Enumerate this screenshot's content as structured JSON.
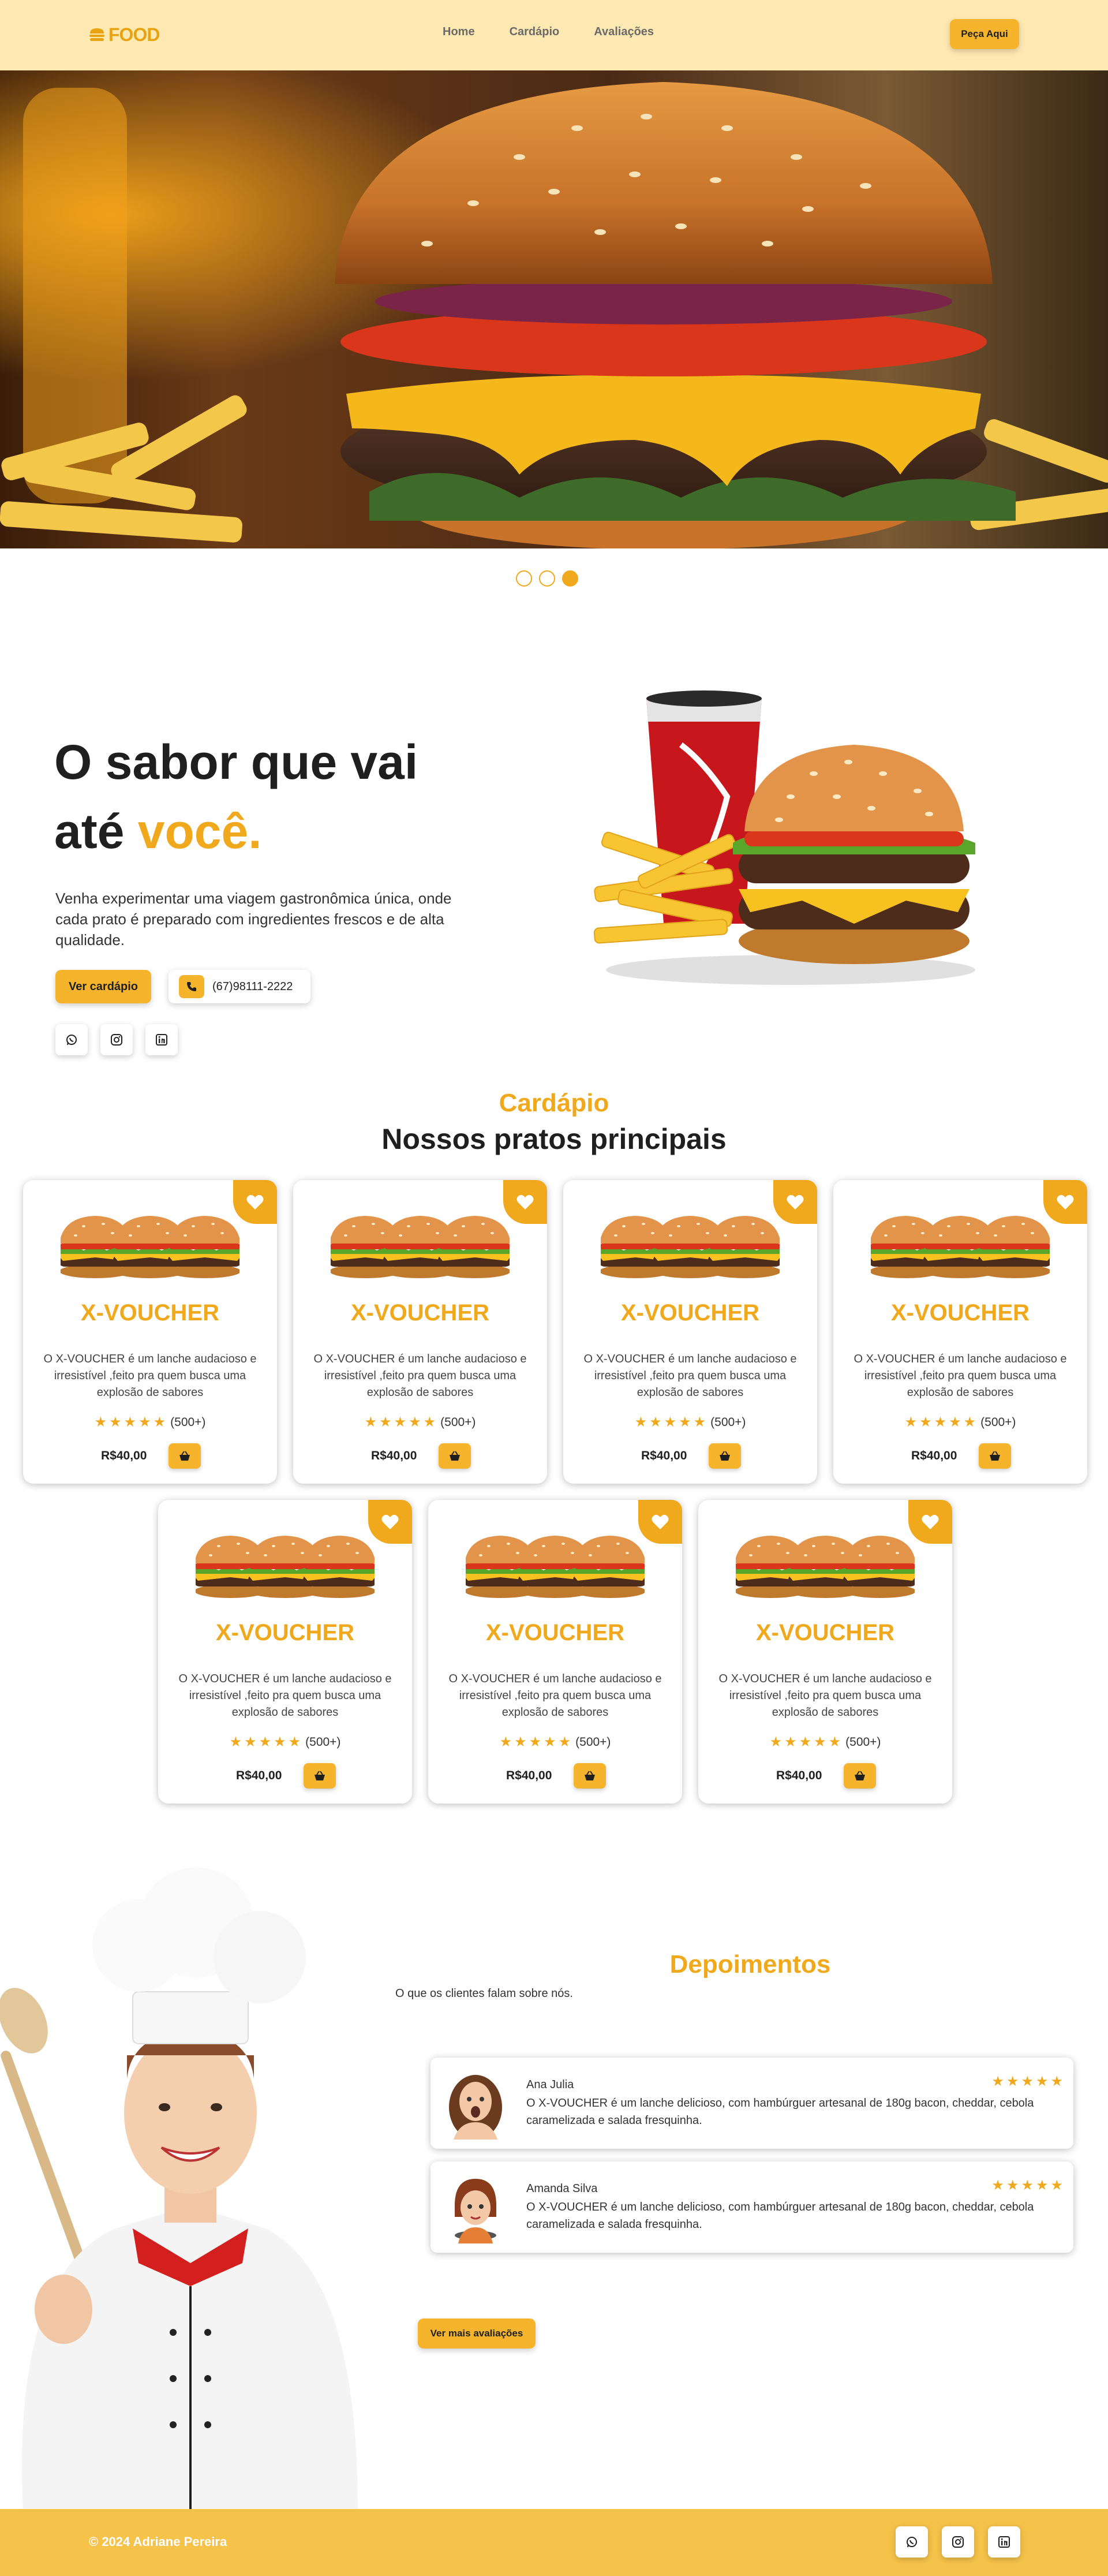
{
  "header": {
    "logo_text": "FOOD",
    "nav": [
      "Home",
      "Cardápio",
      "Avaliações"
    ],
    "order_button": "Peça Aqui"
  },
  "hero": {
    "slides": 3,
    "active_slide": 3
  },
  "intro": {
    "title_line1": "O sabor que vai",
    "title_line2_plain": "até ",
    "title_line2_accent": "você.",
    "description": "Venha experimentar uma viagem gastronômica única, onde cada prato é preparado com ingredientes frescos e de alta qualidade.",
    "menu_button": "Ver cardápio",
    "phone": "(67)98111-2222",
    "social_icons": [
      "whatsapp-icon",
      "instagram-icon",
      "linkedin-icon"
    ]
  },
  "menu": {
    "label": "Cardápio",
    "title": "Nossos pratos principais",
    "items": [
      {
        "name": "X-VOUCHER",
        "description": "O X-VOUCHER é um lanche audacioso e irresistível ,feito pra quem busca uma explosão de sabores",
        "rating": 5,
        "count": "(500+)",
        "price": "R$40,00"
      },
      {
        "name": "X-VOUCHER",
        "description": "O X-VOUCHER é um lanche audacioso e irresistível ,feito pra quem busca uma explosão de sabores",
        "rating": 5,
        "count": "(500+)",
        "price": "R$40,00"
      },
      {
        "name": "X-VOUCHER",
        "description": "O X-VOUCHER é um lanche audacioso e irresistível ,feito pra quem busca uma explosão de sabores",
        "rating": 5,
        "count": "(500+)",
        "price": "R$40,00"
      },
      {
        "name": "X-VOUCHER",
        "description": "O X-VOUCHER é um lanche audacioso e irresistível ,feito pra quem busca uma explosão de sabores",
        "rating": 5,
        "count": "(500+)",
        "price": "R$40,00"
      },
      {
        "name": "X-VOUCHER",
        "description": "O X-VOUCHER é um lanche audacioso e irresistível ,feito pra quem busca uma explosão de sabores",
        "rating": 5,
        "count": "(500+)",
        "price": "R$40,00"
      },
      {
        "name": "X-VOUCHER",
        "description": "O X-VOUCHER é um lanche audacioso e irresistível ,feito pra quem busca uma explosão de sabores",
        "rating": 5,
        "count": "(500+)",
        "price": "R$40,00"
      },
      {
        "name": "X-VOUCHER",
        "description": "O X-VOUCHER é um lanche audacioso e irresistível ,feito pra quem busca uma explosão de sabores",
        "rating": 5,
        "count": "(500+)",
        "price": "R$40,00"
      }
    ]
  },
  "testimonials": {
    "title": "Depoimentos",
    "subtitle": "O que os clientes falam sobre nós.",
    "reviews": [
      {
        "name": "Ana Julia",
        "text": "O X-VOUCHER é um lanche delicioso, com hambúrguer artesanal de 180g bacon, cheddar, cebola caramelizada e salada fresquinha.",
        "rating": 5
      },
      {
        "name": "Amanda Silva",
        "text": "O X-VOUCHER é um lanche delicioso, com hambúrguer artesanal de 180g bacon, cheddar, cebola caramelizada e salada fresquinha.",
        "rating": 5
      }
    ],
    "more_button": "Ver mais avaliações"
  },
  "footer": {
    "copyright": "© 2024 Adriane Pereira",
    "social_icons": [
      "whatsapp-icon",
      "instagram-icon",
      "linkedin-icon"
    ]
  },
  "colors": {
    "accent": "#f0a91d",
    "button": "#f5b42c",
    "header_bg": "#ffe9b2",
    "footer_bg": "#f5c24a"
  }
}
